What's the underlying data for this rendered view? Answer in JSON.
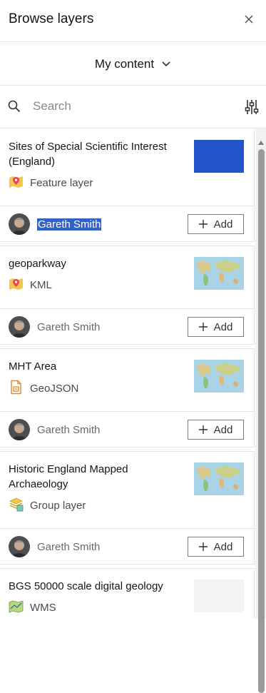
{
  "header": {
    "title": "Browse layers",
    "close_icon": "close-icon"
  },
  "source_dropdown": {
    "label": "My content",
    "icon": "chevron-down-icon"
  },
  "search": {
    "placeholder": "Search",
    "value": "",
    "icon": "search-icon",
    "filter_icon": "filter-sliders-icon"
  },
  "add_label": "Add",
  "colors": {
    "accent": "#3263c4",
    "border": "#e3e3e3"
  },
  "cards": [
    {
      "title": "Sites of Special Scientific Interest (England)",
      "type": "Feature layer",
      "type_icon": "feature-layer-pin-icon",
      "owner": "Gareth Smith",
      "owner_selected": true,
      "thumbnail": "blue-fill"
    },
    {
      "title": "geoparkway",
      "type": "KML",
      "type_icon": "kml-pin-icon",
      "owner": "Gareth Smith",
      "owner_selected": false,
      "thumbnail": "world-map"
    },
    {
      "title": "MHT Area",
      "type": "GeoJSON",
      "type_icon": "geojson-file-icon",
      "owner": "Gareth Smith",
      "owner_selected": false,
      "thumbnail": "world-map"
    },
    {
      "title": "Historic England Mapped Archaeology",
      "type": "Group layer",
      "type_icon": "group-layer-icon",
      "owner": "Gareth Smith",
      "owner_selected": false,
      "thumbnail": "world-map"
    },
    {
      "title": "BGS 50000 scale digital geology",
      "type": "WMS",
      "type_icon": "wms-map-icon",
      "thumbnail": "blank"
    }
  ]
}
